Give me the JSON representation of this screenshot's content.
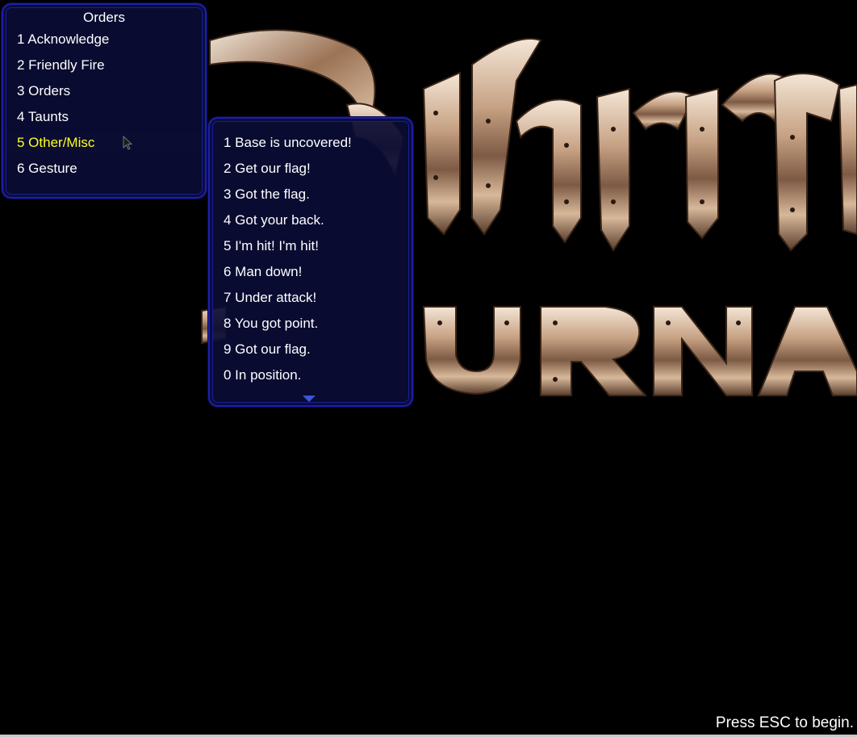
{
  "orders_menu": {
    "title": "Orders",
    "items": [
      {
        "label": "1 Acknowledge"
      },
      {
        "label": "2 Friendly Fire"
      },
      {
        "label": "3 Orders"
      },
      {
        "label": "4 Taunts"
      },
      {
        "label": "5 Other/Misc",
        "selected": true
      },
      {
        "label": "6 Gesture"
      }
    ]
  },
  "submenu": {
    "items": [
      {
        "label": "1 Base is uncovered!"
      },
      {
        "label": "2 Get our flag!"
      },
      {
        "label": "3 Got the flag."
      },
      {
        "label": "4 Got your back."
      },
      {
        "label": "5 I'm hit! I'm hit!"
      },
      {
        "label": "6 Man down!"
      },
      {
        "label": "7 Under attack!"
      },
      {
        "label": "8 You got point."
      },
      {
        "label": "9 Got our flag."
      },
      {
        "label": "0 In position."
      }
    ]
  },
  "footer": {
    "prompt": "Press ESC to begin."
  },
  "colors": {
    "background": "#000000",
    "panel": "#0a0c34",
    "panel_border": "#1c1fa8",
    "text": "#ffffff",
    "selected_text": "#ffff20"
  },
  "icons": {
    "cursor": "mouse-pointer-icon",
    "scroll": "chevron-down-icon"
  }
}
